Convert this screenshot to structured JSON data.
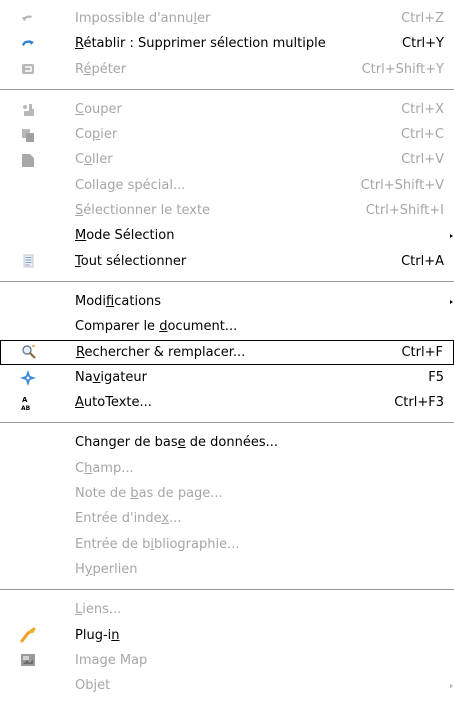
{
  "menu": {
    "groups": [
      [
        {
          "id": "undo",
          "pre": "Impossible d'annu",
          "u": "l",
          "post": "er",
          "shortcut": "Ctrl+Z",
          "disabled": true,
          "icon": "undo-icon"
        },
        {
          "id": "redo",
          "pre": "",
          "u": "R",
          "post": "établir : Supprimer sélection multiple",
          "shortcut": "Ctrl+Y",
          "disabled": false,
          "icon": "redo-icon"
        },
        {
          "id": "repeat",
          "pre": "R",
          "u": "é",
          "post": "péter",
          "shortcut": "Ctrl+Shift+Y",
          "disabled": true,
          "icon": "repeat-icon"
        }
      ],
      [
        {
          "id": "cut",
          "pre": "",
          "u": "C",
          "post": "ouper",
          "shortcut": "Ctrl+X",
          "disabled": true,
          "icon": "cut-icon"
        },
        {
          "id": "copy",
          "pre": "Co",
          "u": "p",
          "post": "ier",
          "shortcut": "Ctrl+C",
          "disabled": true,
          "icon": "copy-icon"
        },
        {
          "id": "paste",
          "pre": "C",
          "u": "o",
          "post": "ller",
          "shortcut": "Ctrl+V",
          "disabled": true,
          "icon": "paste-icon"
        },
        {
          "id": "paste-special",
          "pre": "Colla",
          "u": "g",
          "post": "e spécial...",
          "shortcut": "Ctrl+Shift+V",
          "disabled": true,
          "icon": ""
        },
        {
          "id": "select-text",
          "pre": "",
          "u": "S",
          "post": "électionner le texte",
          "shortcut": "Ctrl+Shift+I",
          "disabled": true,
          "icon": ""
        },
        {
          "id": "selection-mode",
          "pre": "",
          "u": "M",
          "post": "ode Sélection",
          "shortcut": "",
          "disabled": false,
          "icon": "",
          "submenu": true
        },
        {
          "id": "select-all",
          "pre": "",
          "u": "T",
          "post": "out sélectionner",
          "shortcut": "Ctrl+A",
          "disabled": false,
          "icon": "select-all-icon"
        }
      ],
      [
        {
          "id": "changes",
          "pre": "Modi",
          "u": "f",
          "post": "ications",
          "shortcut": "",
          "disabled": false,
          "icon": "",
          "submenu": true
        },
        {
          "id": "compare",
          "pre": "Comparer le ",
          "u": "d",
          "post": "ocument...",
          "shortcut": "",
          "disabled": false,
          "icon": ""
        },
        {
          "id": "find-replace",
          "pre": "",
          "u": "R",
          "post": "echercher & remplacer...",
          "shortcut": "Ctrl+F",
          "disabled": false,
          "icon": "find-replace-icon",
          "highlighted": true
        },
        {
          "id": "navigator",
          "pre": "Na",
          "u": "v",
          "post": "igateur",
          "shortcut": "F5",
          "disabled": false,
          "icon": "navigator-icon"
        },
        {
          "id": "autotext",
          "pre": "",
          "u": "A",
          "post": "utoTexte...",
          "shortcut": "Ctrl+F3",
          "disabled": false,
          "icon": "autotext-icon"
        }
      ],
      [
        {
          "id": "exchange-db",
          "pre": "Changer de bas",
          "u": "e",
          "post": " de données...",
          "shortcut": "",
          "disabled": false,
          "icon": ""
        },
        {
          "id": "field",
          "pre": "C",
          "u": "h",
          "post": "amp...",
          "shortcut": "",
          "disabled": true,
          "icon": ""
        },
        {
          "id": "footnote",
          "pre": "Note de ",
          "u": "b",
          "post": "as de page...",
          "shortcut": "",
          "disabled": true,
          "icon": ""
        },
        {
          "id": "index-entry",
          "pre": "Entrée d'inde",
          "u": "x",
          "post": "...",
          "shortcut": "",
          "disabled": true,
          "icon": ""
        },
        {
          "id": "bibliography-entry",
          "pre": "Entrée de b",
          "u": "i",
          "post": "bliographie...",
          "shortcut": "",
          "disabled": true,
          "icon": ""
        },
        {
          "id": "hyperlink",
          "pre": "H",
          "u": "y",
          "post": "perlien",
          "shortcut": "",
          "disabled": true,
          "icon": ""
        }
      ],
      [
        {
          "id": "links",
          "pre": "",
          "u": "L",
          "post": "iens...",
          "shortcut": "",
          "disabled": true,
          "icon": ""
        },
        {
          "id": "plugin",
          "pre": "Plug-i",
          "u": "n",
          "post": "",
          "shortcut": "",
          "disabled": false,
          "icon": "plugin-icon"
        },
        {
          "id": "image-map",
          "pre": "Ima",
          "u": "g",
          "post": "e Map",
          "shortcut": "",
          "disabled": true,
          "icon": "image-map-icon"
        },
        {
          "id": "object",
          "pre": "Objet",
          "u": "",
          "post": "",
          "shortcut": "",
          "disabled": true,
          "icon": "",
          "submenu": true
        }
      ]
    ]
  },
  "colors": {
    "enabled_text": "#000000",
    "disabled_text": "#a6a6a6",
    "highlight_border": "#000000",
    "separator": "#9a9a9a"
  }
}
